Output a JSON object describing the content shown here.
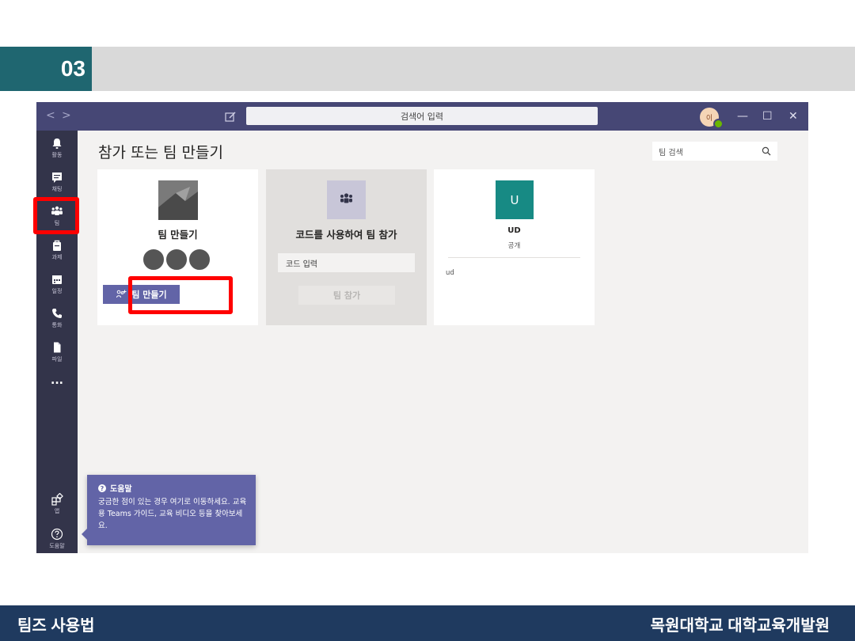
{
  "slide": {
    "number": "03",
    "footer_left": "팀즈 사용법",
    "footer_right": "목원대학교 대학교육개발원"
  },
  "titlebar": {
    "back": "<",
    "forward": ">",
    "search_text": "검색어 입력",
    "avatar_initial": "이",
    "minimize": "—",
    "maximize": "☐",
    "close": "✕"
  },
  "rail": {
    "items": [
      {
        "label": "활동",
        "icon": "bell-icon"
      },
      {
        "label": "채팅",
        "icon": "chat-icon"
      },
      {
        "label": "팀",
        "icon": "teams-icon"
      },
      {
        "label": "과제",
        "icon": "assignments-icon"
      },
      {
        "label": "일정",
        "icon": "calendar-icon"
      },
      {
        "label": "통화",
        "icon": "phone-icon"
      },
      {
        "label": "파일",
        "icon": "file-icon"
      }
    ],
    "more": "...",
    "apps_label": "앱",
    "help_label": "도움말"
  },
  "main": {
    "title": "참가 또는 팀 만들기",
    "search_placeholder": "팀 검색"
  },
  "cards": {
    "create": {
      "title": "팀 만들기",
      "button": "팀 만들기"
    },
    "join": {
      "title": "코드를 사용하여 팀 참가",
      "input_placeholder": "코드 입력",
      "button": "팀 참가"
    },
    "team": {
      "initial": "U",
      "name": "UD",
      "visibility": "공개",
      "description": "ud"
    }
  },
  "help_popup": {
    "title": "도움말",
    "body": "궁금한 점이 있는 경우 여기로 이동하세요. 교육용 Teams 가이드, 교육 비디오 등을 찾아보세요."
  },
  "colors": {
    "titlebar": "#464775",
    "rail": "#33344a",
    "accent": "#6264a7",
    "team_tile": "#178a84",
    "highlight": "#ff0000",
    "slide_number_bg": "#1f6670",
    "footer_bg": "#1f3a5f"
  }
}
